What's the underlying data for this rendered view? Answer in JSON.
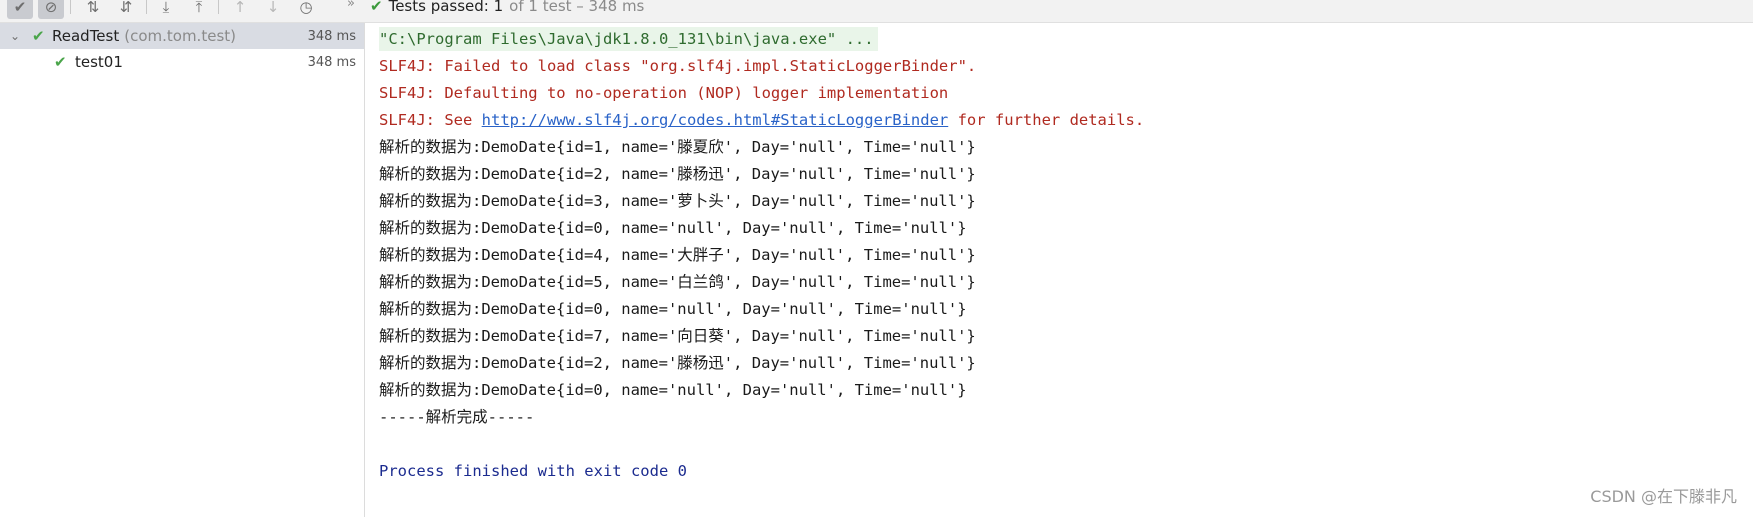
{
  "toolbar": {
    "buttons": [
      {
        "icon": "check-icon",
        "glyph": "✔"
      },
      {
        "icon": "stop-icon",
        "glyph": "⊘"
      },
      {
        "icon": "sort-alpha-icon",
        "glyph": "⇅"
      },
      {
        "icon": "sort-duration-icon",
        "glyph": "⇵"
      },
      {
        "icon": "expand-all-icon",
        "glyph": "⤓"
      },
      {
        "icon": "collapse-all-icon",
        "glyph": "⤒"
      },
      {
        "icon": "previous-failed-icon",
        "glyph": "↑"
      },
      {
        "icon": "next-failed-icon",
        "glyph": "↓"
      },
      {
        "icon": "history-icon",
        "glyph": "◷"
      }
    ],
    "more_glyph": "»",
    "status_main": "Tests passed: 1",
    "status_sub": "of 1 test – 348 ms",
    "status_icon_glyph": "✔"
  },
  "tree": {
    "items": [
      {
        "arrow": "⌄",
        "check": "✔",
        "name": "ReadTest",
        "package": "(com.tom.test)",
        "time": "348 ms"
      },
      {
        "check": "✔",
        "name": "test01",
        "time": "348 ms"
      }
    ]
  },
  "console": {
    "command": "\"C:\\Program Files\\Java\\jdk1.8.0_131\\bin\\java.exe\" ...",
    "errors": [
      "SLF4J: Failed to load class \"org.slf4j.impl.StaticLoggerBinder\".",
      "SLF4J: Defaulting to no-operation (NOP) logger implementation"
    ],
    "see_prefix": "SLF4J: See ",
    "see_link": "http://www.slf4j.org/codes.html#StaticLoggerBinder",
    "see_suffix": " for further details.",
    "outputs": [
      "解析的数据为:DemoDate{id=1, name='滕夏欣', Day='null', Time='null'}",
      "解析的数据为:DemoDate{id=2, name='滕杨迅', Day='null', Time='null'}",
      "解析的数据为:DemoDate{id=3, name='萝卜头', Day='null', Time='null'}",
      "解析的数据为:DemoDate{id=0, name='null', Day='null', Time='null'}",
      "解析的数据为:DemoDate{id=4, name='大胖子', Day='null', Time='null'}",
      "解析的数据为:DemoDate{id=5, name='白兰鸽', Day='null', Time='null'}",
      "解析的数据为:DemoDate{id=0, name='null', Day='null', Time='null'}",
      "解析的数据为:DemoDate{id=7, name='向日葵', Day='null', Time='null'}",
      "解析的数据为:DemoDate{id=2, name='滕杨迅', Day='null', Time='null'}",
      "解析的数据为:DemoDate{id=0, name='null', Day='null', Time='null'}"
    ],
    "done": "-----解析完成-----",
    "exit": "Process finished with exit code 0"
  },
  "watermark": "CSDN @在下滕非凡"
}
